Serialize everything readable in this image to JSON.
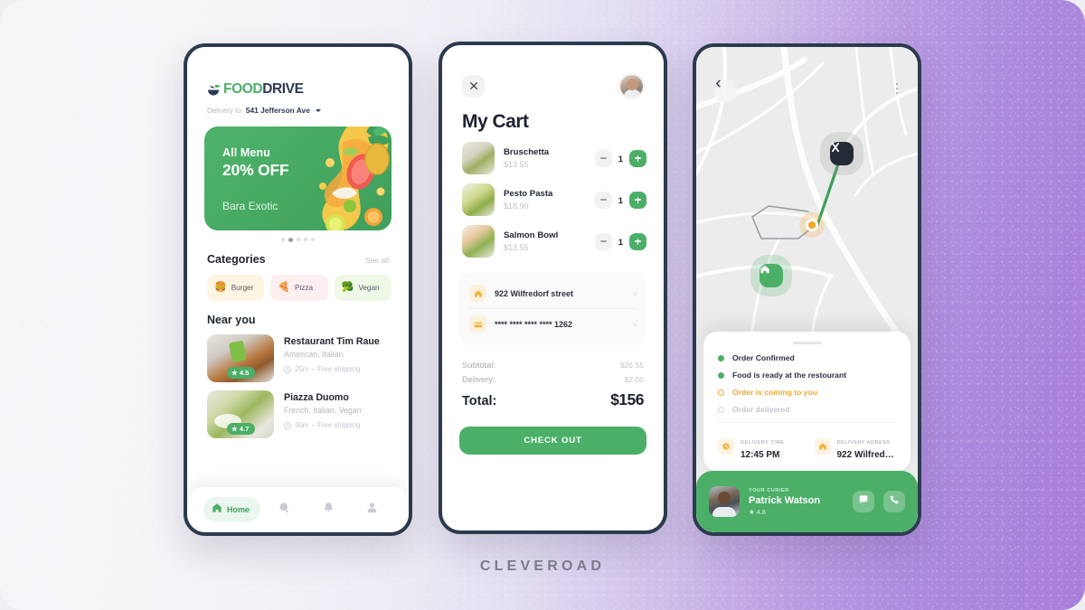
{
  "watermark": "CLEVEROAD",
  "colors": {
    "green": "#4caf68",
    "navy": "#2c3a4e",
    "orange": "#f0a82c",
    "purple": "#a87fdb"
  },
  "home": {
    "logo": {
      "food": "FOOD",
      "drive": "DRIVE",
      "icon": "leaf-bowl-icon"
    },
    "delivery_label": "Delivery to",
    "delivery_address": "541 Jefferson Ave",
    "banner": {
      "kicker": "All Menu",
      "headline": "20% OFF",
      "sub": "Bara Exotic",
      "dots": 5,
      "active_dot": 2
    },
    "categories_title": "Categories",
    "see_all": "See all",
    "categories": [
      {
        "label": "Burger",
        "emoji": "🍔",
        "bg": "#fdf4e2"
      },
      {
        "label": "Pizza",
        "emoji": "🍕",
        "bg": "#fdeef0"
      },
      {
        "label": "Vegan",
        "emoji": "🥦",
        "bg": "#eff8e6"
      }
    ],
    "near_you_title": "Near you",
    "restaurants": [
      {
        "name": "Restaurant Tim Raue",
        "cuisine": "American, Italian",
        "rating": "4.5",
        "time": "25m",
        "shipping": "Free shipping"
      },
      {
        "name": "Piazza Duomo",
        "cuisine": "French, Italian, Vegan",
        "rating": "4.7",
        "time": "30m",
        "shipping": "Free shipping"
      }
    ],
    "tabs": [
      {
        "label": "Home",
        "icon": "home-icon",
        "active": true
      },
      {
        "label": "",
        "icon": "search-icon",
        "active": false
      },
      {
        "label": "",
        "icon": "bell-icon",
        "active": false
      },
      {
        "label": "",
        "icon": "profile-icon",
        "active": false
      }
    ]
  },
  "cart": {
    "close_icon": "close-icon",
    "avatar": "user-avatar",
    "title": "My Cart",
    "items": [
      {
        "name": "Bruschetta",
        "price": "$13.55",
        "qty": "1"
      },
      {
        "name": "Pesto Pasta",
        "price": "$18.90",
        "qty": "1"
      },
      {
        "name": "Salmon Bowl",
        "price": "$13.55",
        "qty": "1"
      }
    ],
    "address": {
      "icon": "home-icon",
      "text": "922 Wilfredorf street"
    },
    "payment": {
      "icon": "card-icon",
      "text": "**** **** **** **** 1262"
    },
    "subtotal_label": "Subtotal:",
    "subtotal_value": "$26.55",
    "delivery_label": "Delivery:",
    "delivery_value": "$2.00",
    "total_label": "Total:",
    "total_value": "$156",
    "checkout_label": "CHECK OUT"
  },
  "tracking": {
    "back_icon": "chevron-left-icon",
    "menu_icon": "more-vertical-icon",
    "markers": {
      "restaurant": "restaurant-marker",
      "courier": "courier-marker",
      "home": "home-marker"
    },
    "steps": [
      {
        "label": "Order Confirmed",
        "state": "done"
      },
      {
        "label": "Food is ready at the restourant",
        "state": "done"
      },
      {
        "label": "Order is coming to you",
        "state": "active"
      },
      {
        "label": "Order delivered",
        "state": "todo"
      }
    ],
    "delivery_time_caption": "DELIVERY TIME",
    "delivery_time_value": "12:45 PM",
    "delivery_address_caption": "DELIVERY ADRESS",
    "delivery_address_value": "922 Wilfredo…",
    "courier_caption": "YOUR CURIER",
    "courier_name": "Patrick Watson",
    "courier_rating": "4.8",
    "chat_icon": "chat-icon",
    "call_icon": "phone-icon"
  }
}
